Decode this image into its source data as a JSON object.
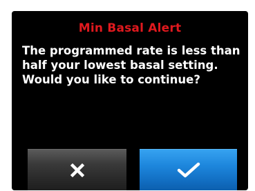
{
  "alert": {
    "title": "Min Basal Alert",
    "message_lines": [
      "The programmed rate is less than",
      "half your lowest basal setting.",
      "Would you like to continue?"
    ]
  },
  "buttons": {
    "cancel_icon": "close-icon",
    "confirm_icon": "checkmark-icon"
  },
  "colors": {
    "title": "#e0191e",
    "text": "#ffffff",
    "screen_background": "#000000",
    "confirm_button": "#1d86dc",
    "cancel_button": "#3a3a3a"
  }
}
